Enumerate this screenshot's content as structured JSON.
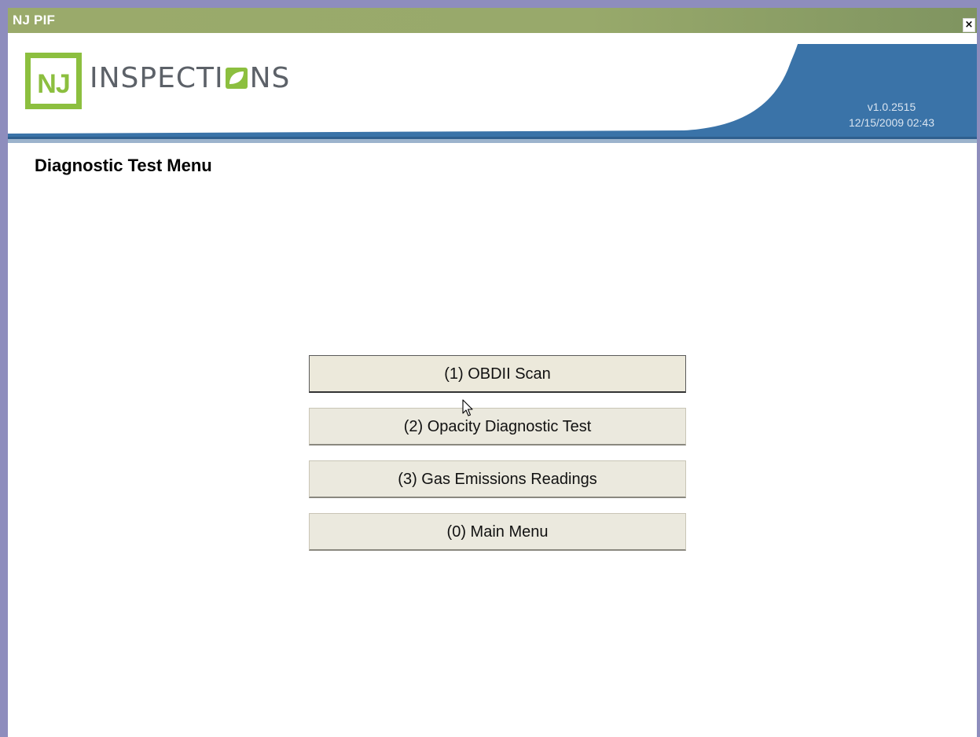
{
  "window": {
    "title": "NJ PIF",
    "close_glyph": "×"
  },
  "header": {
    "logo_box_text": "NJ",
    "logo_word_before": "INSPECTI",
    "logo_word_after": "NS",
    "version": "v1.0.2515",
    "datetime": "12/15/2009 02:43",
    "colors": {
      "brand_green": "#8cbf3f",
      "header_blue": "#3a73a8"
    }
  },
  "page": {
    "title": "Diagnostic Test Menu"
  },
  "menu": {
    "buttons": [
      {
        "label": "(1) OBDII Scan"
      },
      {
        "label": "(2) Opacity Diagnostic Test"
      },
      {
        "label": "(3) Gas Emissions Readings"
      },
      {
        "label": "(0) Main Menu"
      }
    ]
  },
  "icons": {
    "close": "close-icon",
    "cursor": "mouse-pointer-icon",
    "logo_leaf": "leaf-icon"
  }
}
